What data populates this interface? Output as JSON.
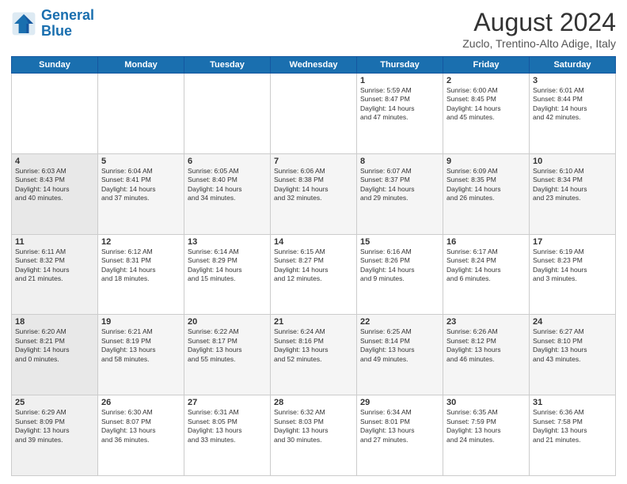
{
  "logo": {
    "line1": "General",
    "line2": "Blue"
  },
  "title": "August 2024",
  "location": "Zuclo, Trentino-Alto Adige, Italy",
  "days_of_week": [
    "Sunday",
    "Monday",
    "Tuesday",
    "Wednesday",
    "Thursday",
    "Friday",
    "Saturday"
  ],
  "weeks": [
    [
      {
        "day": "",
        "info": ""
      },
      {
        "day": "",
        "info": ""
      },
      {
        "day": "",
        "info": ""
      },
      {
        "day": "",
        "info": ""
      },
      {
        "day": "1",
        "info": "Sunrise: 5:59 AM\nSunset: 8:47 PM\nDaylight: 14 hours\nand 47 minutes."
      },
      {
        "day": "2",
        "info": "Sunrise: 6:00 AM\nSunset: 8:45 PM\nDaylight: 14 hours\nand 45 minutes."
      },
      {
        "day": "3",
        "info": "Sunrise: 6:01 AM\nSunset: 8:44 PM\nDaylight: 14 hours\nand 42 minutes."
      }
    ],
    [
      {
        "day": "4",
        "info": "Sunrise: 6:03 AM\nSunset: 8:43 PM\nDaylight: 14 hours\nand 40 minutes."
      },
      {
        "day": "5",
        "info": "Sunrise: 6:04 AM\nSunset: 8:41 PM\nDaylight: 14 hours\nand 37 minutes."
      },
      {
        "day": "6",
        "info": "Sunrise: 6:05 AM\nSunset: 8:40 PM\nDaylight: 14 hours\nand 34 minutes."
      },
      {
        "day": "7",
        "info": "Sunrise: 6:06 AM\nSunset: 8:38 PM\nDaylight: 14 hours\nand 32 minutes."
      },
      {
        "day": "8",
        "info": "Sunrise: 6:07 AM\nSunset: 8:37 PM\nDaylight: 14 hours\nand 29 minutes."
      },
      {
        "day": "9",
        "info": "Sunrise: 6:09 AM\nSunset: 8:35 PM\nDaylight: 14 hours\nand 26 minutes."
      },
      {
        "day": "10",
        "info": "Sunrise: 6:10 AM\nSunset: 8:34 PM\nDaylight: 14 hours\nand 23 minutes."
      }
    ],
    [
      {
        "day": "11",
        "info": "Sunrise: 6:11 AM\nSunset: 8:32 PM\nDaylight: 14 hours\nand 21 minutes."
      },
      {
        "day": "12",
        "info": "Sunrise: 6:12 AM\nSunset: 8:31 PM\nDaylight: 14 hours\nand 18 minutes."
      },
      {
        "day": "13",
        "info": "Sunrise: 6:14 AM\nSunset: 8:29 PM\nDaylight: 14 hours\nand 15 minutes."
      },
      {
        "day": "14",
        "info": "Sunrise: 6:15 AM\nSunset: 8:27 PM\nDaylight: 14 hours\nand 12 minutes."
      },
      {
        "day": "15",
        "info": "Sunrise: 6:16 AM\nSunset: 8:26 PM\nDaylight: 14 hours\nand 9 minutes."
      },
      {
        "day": "16",
        "info": "Sunrise: 6:17 AM\nSunset: 8:24 PM\nDaylight: 14 hours\nand 6 minutes."
      },
      {
        "day": "17",
        "info": "Sunrise: 6:19 AM\nSunset: 8:23 PM\nDaylight: 14 hours\nand 3 minutes."
      }
    ],
    [
      {
        "day": "18",
        "info": "Sunrise: 6:20 AM\nSunset: 8:21 PM\nDaylight: 14 hours\nand 0 minutes."
      },
      {
        "day": "19",
        "info": "Sunrise: 6:21 AM\nSunset: 8:19 PM\nDaylight: 13 hours\nand 58 minutes."
      },
      {
        "day": "20",
        "info": "Sunrise: 6:22 AM\nSunset: 8:17 PM\nDaylight: 13 hours\nand 55 minutes."
      },
      {
        "day": "21",
        "info": "Sunrise: 6:24 AM\nSunset: 8:16 PM\nDaylight: 13 hours\nand 52 minutes."
      },
      {
        "day": "22",
        "info": "Sunrise: 6:25 AM\nSunset: 8:14 PM\nDaylight: 13 hours\nand 49 minutes."
      },
      {
        "day": "23",
        "info": "Sunrise: 6:26 AM\nSunset: 8:12 PM\nDaylight: 13 hours\nand 46 minutes."
      },
      {
        "day": "24",
        "info": "Sunrise: 6:27 AM\nSunset: 8:10 PM\nDaylight: 13 hours\nand 43 minutes."
      }
    ],
    [
      {
        "day": "25",
        "info": "Sunrise: 6:29 AM\nSunset: 8:09 PM\nDaylight: 13 hours\nand 39 minutes."
      },
      {
        "day": "26",
        "info": "Sunrise: 6:30 AM\nSunset: 8:07 PM\nDaylight: 13 hours\nand 36 minutes."
      },
      {
        "day": "27",
        "info": "Sunrise: 6:31 AM\nSunset: 8:05 PM\nDaylight: 13 hours\nand 33 minutes."
      },
      {
        "day": "28",
        "info": "Sunrise: 6:32 AM\nSunset: 8:03 PM\nDaylight: 13 hours\nand 30 minutes."
      },
      {
        "day": "29",
        "info": "Sunrise: 6:34 AM\nSunset: 8:01 PM\nDaylight: 13 hours\nand 27 minutes."
      },
      {
        "day": "30",
        "info": "Sunrise: 6:35 AM\nSunset: 7:59 PM\nDaylight: 13 hours\nand 24 minutes."
      },
      {
        "day": "31",
        "info": "Sunrise: 6:36 AM\nSunset: 7:58 PM\nDaylight: 13 hours\nand 21 minutes."
      }
    ]
  ]
}
